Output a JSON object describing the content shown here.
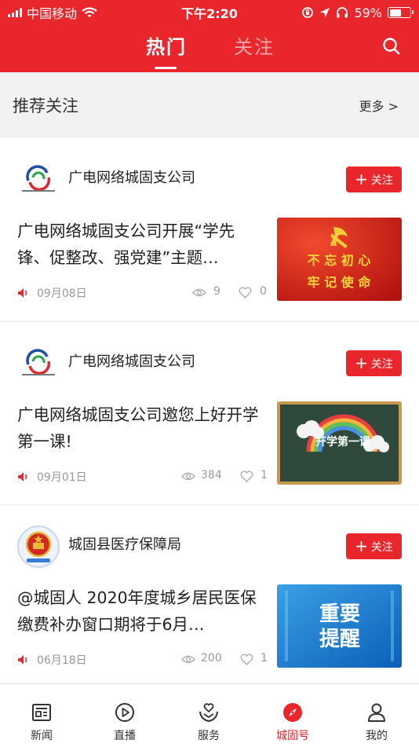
{
  "status_bar": {
    "carrier": "中国移动",
    "time": "下午2:20",
    "battery": "59%",
    "battery_level": 0.59
  },
  "header": {
    "tabs": [
      "热门",
      "关注"
    ],
    "active_tab": 0
  },
  "recommend": {
    "title": "推荐关注",
    "more": "更多 >"
  },
  "follow_label": "关注",
  "feed": [
    {
      "source": "广电网络城固支公司",
      "headline": "广电网络城固支公司开展“学先锋、促整改、强党建”主题…",
      "date": "09月08日",
      "views": "9",
      "likes": "0",
      "thumb_text": [
        "不 忘 初 心",
        "牢 记 使 命"
      ]
    },
    {
      "source": "广电网络城固支公司",
      "headline": "广电网络城固支公司邀您上好开学第一课!",
      "date": "09月01日",
      "views": "384",
      "likes": "1",
      "thumb_text": [
        "开学第一课"
      ]
    },
    {
      "source": "城固县医疗保障局",
      "headline": "@城固人  2020年度城乡居民医保缴费补办窗口期将于6月…",
      "date": "06月18日",
      "views": "200",
      "likes": "1",
      "thumb_text": [
        "重要",
        "提醒"
      ]
    }
  ],
  "bottom_nav": [
    {
      "label": "新闻",
      "icon": "news-icon"
    },
    {
      "label": "直播",
      "icon": "live-icon"
    },
    {
      "label": "服务",
      "icon": "service-icon"
    },
    {
      "label": "城固号",
      "icon": "compass-icon"
    },
    {
      "label": "我的",
      "icon": "profile-icon"
    }
  ],
  "active_nav": 3,
  "colors": {
    "brand_red": "#e8262c",
    "gray_text": "#999999",
    "page_bg": "#f2f2f2"
  }
}
